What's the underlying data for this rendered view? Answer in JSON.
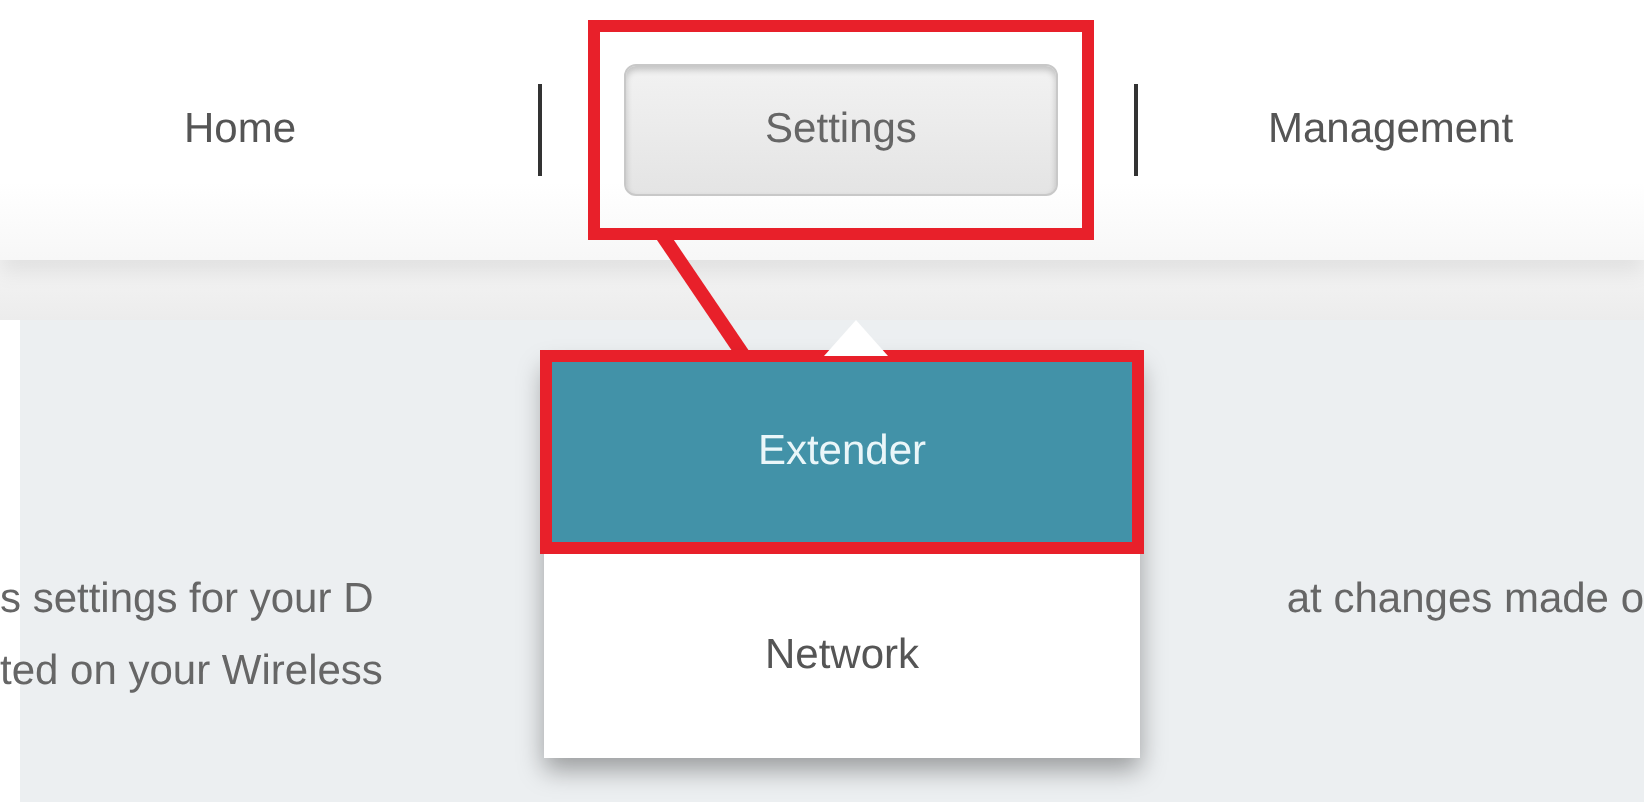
{
  "nav": {
    "items": [
      {
        "label": "Home",
        "kind": "link",
        "selected": false,
        "highlighted": false
      },
      {
        "label": "Settings",
        "kind": "button",
        "selected": true,
        "highlighted": true
      },
      {
        "label": "Management",
        "kind": "link",
        "selected": false,
        "highlighted": false
      }
    ]
  },
  "dropdown": {
    "items": [
      {
        "label": "Extender",
        "selected": true,
        "highlighted": true
      },
      {
        "label": "Network",
        "selected": false,
        "highlighted": false
      }
    ]
  },
  "body_text": [
    {
      "left": "s settings for your D",
      "right": "at changes made o"
    },
    {
      "left": "ted on your Wireless"
    }
  ]
}
